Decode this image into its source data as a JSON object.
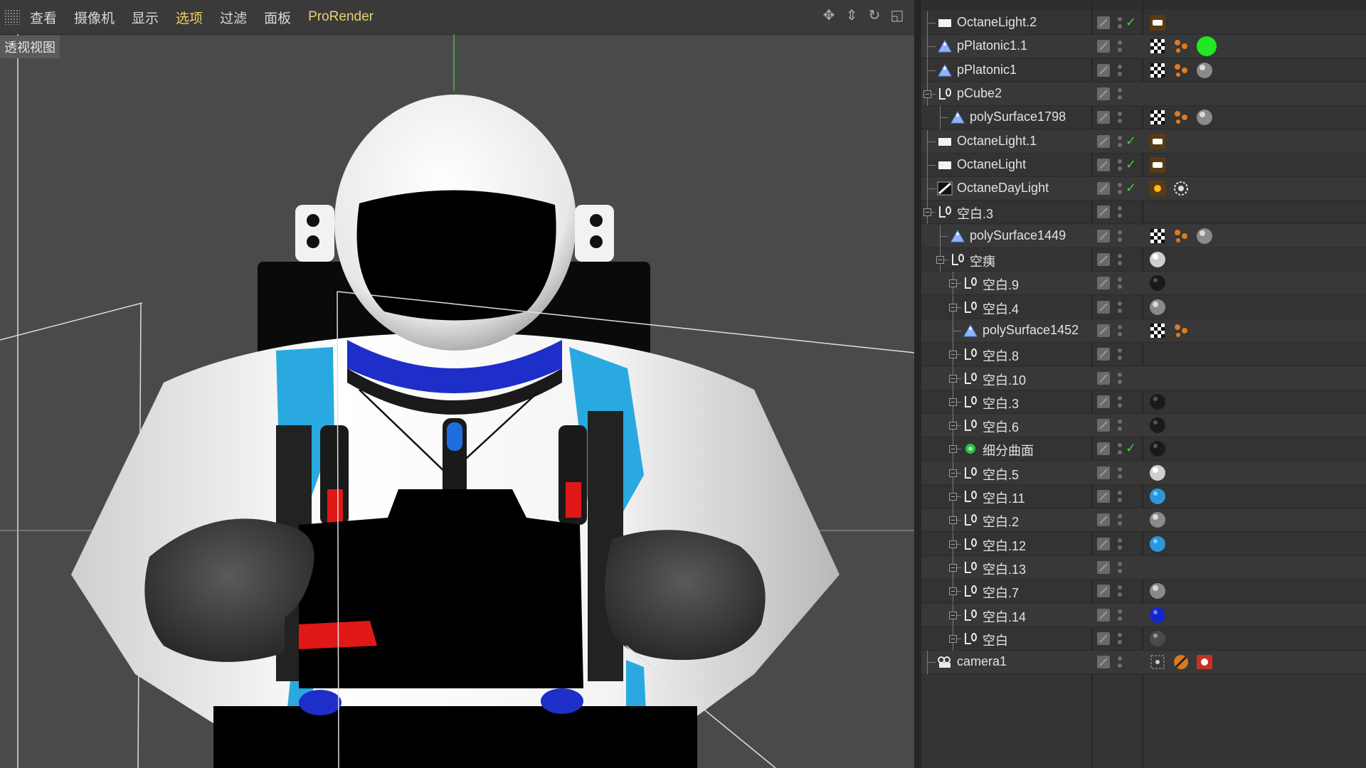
{
  "viewport": {
    "menu": [
      "查看",
      "摄像机",
      "显示",
      "选项",
      "过滤",
      "面板",
      "ProRender"
    ],
    "active_menu": "选项",
    "label": "透视视图"
  },
  "object_manager": {
    "rows": [
      {
        "name": "OctaneLight.2",
        "depth": 0,
        "icon": "light-rect-icon",
        "check": true,
        "tags": [
          "octane-light-tag-icon"
        ]
      },
      {
        "name": "pPlatonic1.1",
        "depth": 0,
        "icon": "polygon-object-icon",
        "check": false,
        "tags": [
          "texture-tag-icon",
          "phong-tag-icon",
          "material-green-icon"
        ]
      },
      {
        "name": "pPlatonic1",
        "depth": 0,
        "icon": "polygon-object-icon",
        "check": false,
        "tags": [
          "texture-tag-icon",
          "phong-tag-icon",
          "material-grey-icon"
        ]
      },
      {
        "name": "pCube2",
        "depth": 0,
        "icon": "null-object-icon",
        "expandable": true,
        "check": false,
        "tags": []
      },
      {
        "name": "polySurface1798",
        "depth": 1,
        "icon": "polygon-object-icon",
        "check": false,
        "tags": [
          "texture-tag-icon",
          "phong-tag-icon",
          "material-grey-icon"
        ]
      },
      {
        "name": "OctaneLight.1",
        "depth": 0,
        "icon": "light-rect-icon",
        "check": true,
        "tags": [
          "octane-light-tag-icon"
        ]
      },
      {
        "name": "OctaneLight",
        "depth": 0,
        "icon": "light-rect-icon",
        "check": true,
        "tags": [
          "octane-light-tag-icon"
        ]
      },
      {
        "name": "OctaneDayLight",
        "depth": 0,
        "icon": "daylight-icon",
        "check": true,
        "tags": [
          "sun-tag-icon",
          "daylight-tag-icon"
        ]
      },
      {
        "name": "空白.3",
        "depth": 0,
        "icon": "null-object-icon",
        "expandable": true,
        "check": false,
        "tags": []
      },
      {
        "name": "polySurface1449",
        "depth": 1,
        "icon": "polygon-object-icon",
        "check": false,
        "tags": [
          "texture-tag-icon",
          "phong-tag-icon",
          "material-grey-icon"
        ]
      },
      {
        "name": "空痍",
        "depth": 1,
        "icon": "null-object-icon",
        "expandable": true,
        "check": false,
        "tags": [
          "material-white-icon"
        ]
      },
      {
        "name": "空白.9",
        "depth": 2,
        "icon": "null-object-icon",
        "expandable": true,
        "check": false,
        "tags": [
          "material-black-icon"
        ]
      },
      {
        "name": "空白.4",
        "depth": 2,
        "icon": "null-object-icon",
        "expandable": true,
        "check": false,
        "tags": [
          "material-grey-icon"
        ]
      },
      {
        "name": "polySurface1452",
        "depth": 2,
        "icon": "polygon-object-icon",
        "check": false,
        "tags": [
          "texture-tag-icon",
          "phong-tag-icon"
        ]
      },
      {
        "name": "空白.8",
        "depth": 2,
        "icon": "null-object-icon",
        "expandable": true,
        "check": false,
        "tags": []
      },
      {
        "name": "空白.10",
        "depth": 2,
        "icon": "null-object-icon",
        "expandable": true,
        "check": false,
        "tags": []
      },
      {
        "name": "空白.3",
        "depth": 2,
        "icon": "null-object-icon",
        "expandable": true,
        "check": false,
        "tags": [
          "material-black-icon"
        ]
      },
      {
        "name": "空白.6",
        "depth": 2,
        "icon": "null-object-icon",
        "expandable": true,
        "check": false,
        "tags": [
          "material-black-icon"
        ]
      },
      {
        "name": "细分曲面",
        "depth": 2,
        "icon": "subdivision-surface-icon",
        "expandable": true,
        "check": true,
        "tags": [
          "material-black-icon"
        ]
      },
      {
        "name": "空白.5",
        "depth": 2,
        "icon": "null-object-icon",
        "expandable": true,
        "check": false,
        "tags": [
          "material-white-icon"
        ]
      },
      {
        "name": "空白.11",
        "depth": 2,
        "icon": "null-object-icon",
        "expandable": true,
        "check": false,
        "tags": [
          "material-blue-icon"
        ]
      },
      {
        "name": "空白.2",
        "depth": 2,
        "icon": "null-object-icon",
        "expandable": true,
        "check": false,
        "tags": [
          "material-grey-icon"
        ]
      },
      {
        "name": "空白.12",
        "depth": 2,
        "icon": "null-object-icon",
        "expandable": true,
        "check": false,
        "tags": [
          "material-blue-icon"
        ]
      },
      {
        "name": "空白.13",
        "depth": 2,
        "icon": "null-object-icon",
        "expandable": true,
        "check": false,
        "tags": []
      },
      {
        "name": "空白.7",
        "depth": 2,
        "icon": "null-object-icon",
        "expandable": true,
        "check": false,
        "tags": [
          "material-grey-icon"
        ]
      },
      {
        "name": "空白.14",
        "depth": 2,
        "icon": "null-object-icon",
        "expandable": true,
        "check": false,
        "tags": [
          "material-darkblue-icon"
        ]
      },
      {
        "name": "空白",
        "depth": 2,
        "icon": "null-object-icon",
        "expandable": true,
        "check": false,
        "tags": [
          "material-darkgrey-icon"
        ]
      },
      {
        "name": "camera1",
        "depth": 0,
        "icon": "camera-icon",
        "check": false,
        "tags": [
          "camera-target-tag-icon",
          "protection-tag-icon",
          "render-camera-tag-icon"
        ]
      }
    ]
  },
  "colors": {
    "viewport_bg": "#4a4a4a",
    "panel_bg": "#333333",
    "check_green": "#3fd23f",
    "accent_yellow": "#f0d060",
    "suit_blue": "#29a9e0"
  }
}
